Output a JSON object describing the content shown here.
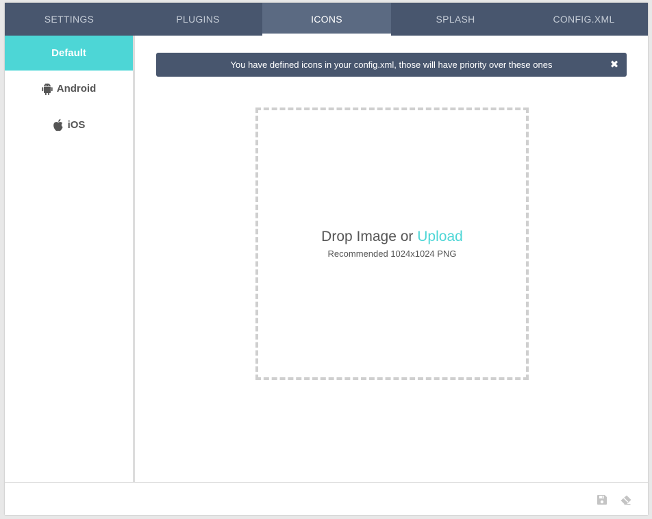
{
  "tabs": [
    {
      "label": "SETTINGS"
    },
    {
      "label": "PLUGINS"
    },
    {
      "label": "ICONS"
    },
    {
      "label": "SPLASH"
    },
    {
      "label": "CONFIG.XML"
    }
  ],
  "active_tab": "ICONS",
  "sidebar": {
    "items": [
      {
        "label": "Default",
        "icon": null
      },
      {
        "label": "Android",
        "icon": "android-icon"
      },
      {
        "label": "iOS",
        "icon": "apple-icon"
      }
    ]
  },
  "notice": {
    "text": "You have defined icons in your config.xml, those will have priority over these ones",
    "close_glyph": "✖"
  },
  "dropzone": {
    "title_prefix": "Drop Image or",
    "upload_label": "Upload",
    "subtitle": "Recommended 1024x1024 PNG"
  },
  "footer": {
    "icons": [
      "save-icon",
      "eraser-icon"
    ]
  },
  "colors": {
    "header_bg": "#48566e",
    "active_tab_bg": "#5b6a82",
    "accent": "#4dd6d6",
    "dash": "#cfcfcf"
  }
}
